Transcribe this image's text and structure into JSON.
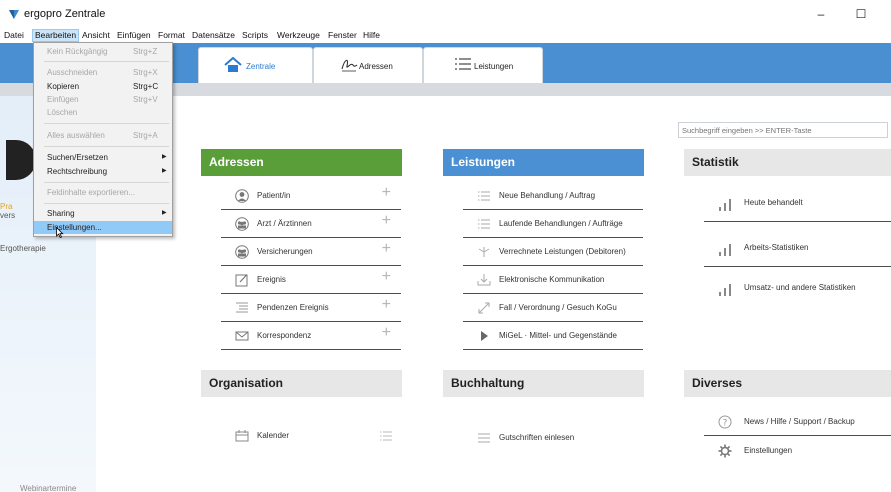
{
  "window": {
    "title": "ergopro Zentrale",
    "minimize": "–",
    "maximize": "☐",
    "close": "✕"
  },
  "menubar": [
    "Datei",
    "Bearbeiten",
    "Ansicht",
    "Einfügen",
    "Format",
    "Datensätze",
    "Scripts",
    "Werkzeuge",
    "Fenster",
    "Hilfe"
  ],
  "dropdown": {
    "items": [
      {
        "label": "Kein Rückgängig",
        "shortcut": "Strg+Z"
      },
      {
        "label": "Ausschneiden",
        "shortcut": "Strg+X"
      },
      {
        "label": "Kopieren",
        "shortcut": "Strg+C"
      },
      {
        "label": "Einfügen",
        "shortcut": "Strg+V"
      },
      {
        "label": "Löschen",
        "shortcut": ""
      },
      {
        "label": "Alles auswählen",
        "shortcut": "Strg+A"
      },
      {
        "label": "Suchen/Ersetzen",
        "shortcut": ""
      },
      {
        "label": "Rechtschreibung",
        "shortcut": ""
      },
      {
        "label": "Feldinhalte exportieren...",
        "shortcut": ""
      },
      {
        "label": "Sharing",
        "shortcut": ""
      },
      {
        "label": "Einstellungen...",
        "shortcut": ""
      }
    ]
  },
  "tabs": {
    "zentrale": "Zentrale",
    "adressen": "Adressen",
    "leistungen": "Leistungen"
  },
  "sidebar": {
    "text1": "Pra",
    "text2": "vers",
    "text3": "Ergotherapie",
    "bottom": "Webinartermine"
  },
  "search": {
    "placeholder": "Suchbegriff eingeben >> ENTER-Taste"
  },
  "sections": {
    "adressen": {
      "title": "Adressen",
      "rows": [
        "Patient/in",
        "Arzt / Ärztinnen",
        "Versicherungen",
        "Ereignis",
        "Pendenzen Ereignis",
        "Korrespondenz"
      ]
    },
    "leistungen": {
      "title": "Leistungen",
      "rows": [
        "Neue Behandlung / Auftrag",
        "Laufende Behandlungen / Aufträge",
        "Verrechnete Leistungen (Debitoren)",
        "Elektronische Kommunikation",
        "Fall / Verordnung / Gesuch KoGu",
        "MiGeL · Mittel- und Gegenstände"
      ]
    },
    "statistik": {
      "title": "Statistik",
      "rows": [
        "Heute behandelt",
        "Arbeits-Statistiken",
        "Umsatz- und andere Statistiken"
      ]
    },
    "organisation": {
      "title": "Organisation",
      "rows": [
        "Kalender"
      ]
    },
    "buchhaltung": {
      "title": "Buchhaltung",
      "rows": [
        "Gutschriften einlesen"
      ]
    },
    "diverses": {
      "title": "Diverses",
      "rows": [
        "News / Hilfe / Support / Backup",
        "Einstellungen"
      ]
    }
  },
  "plus": "+",
  "colors": {
    "header_blue": "#4a8fd1",
    "adressen_green": "#5a9e3a",
    "leistungen_blue": "#4a90d2",
    "menu_highlight": "#91c9f7"
  }
}
